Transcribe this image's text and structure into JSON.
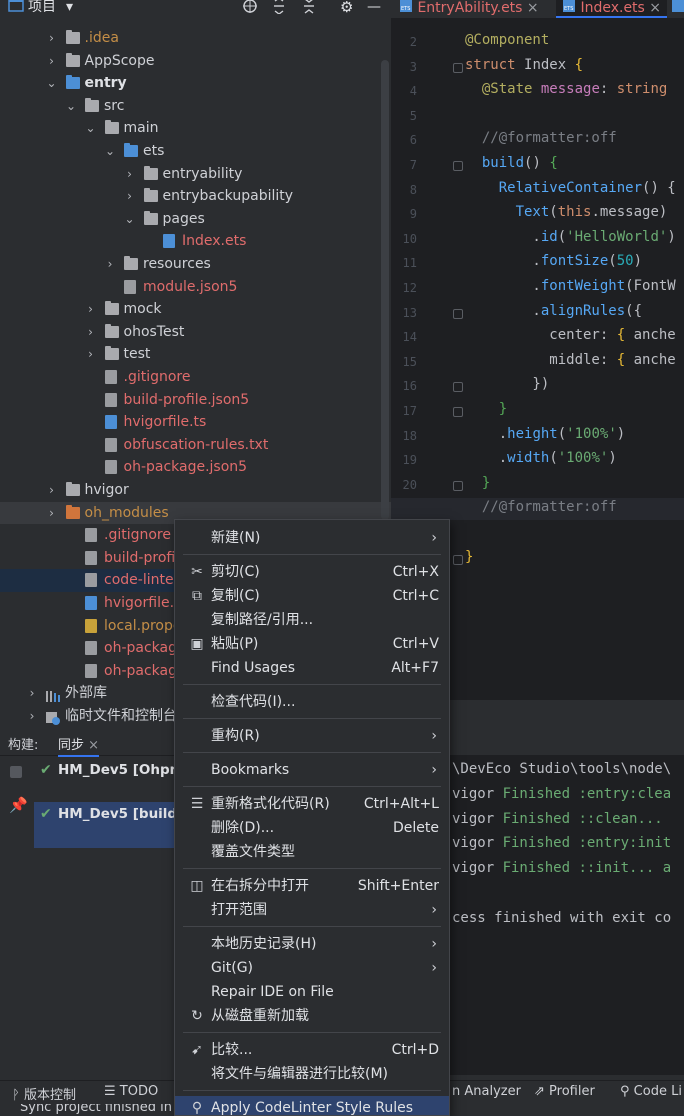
{
  "project_toolbar": {
    "title": "项目",
    "dropdown_glyph": "▾",
    "icons": [
      "target-icon",
      "expand-icon",
      "collapse-icon",
      "gear-icon",
      "minimize-icon"
    ]
  },
  "tabs": [
    {
      "label": "EntryAbility.ets",
      "close": "×"
    },
    {
      "label": "Index.ets",
      "close": "×"
    }
  ],
  "tree": [
    {
      "label": ".idea",
      "color": "orange",
      "depth": 1,
      "chev": "›",
      "icon": "folder"
    },
    {
      "label": "AppScope",
      "color": "norm",
      "depth": 1,
      "chev": "›",
      "icon": "folder"
    },
    {
      "label": "entry",
      "color": "bold",
      "depth": 1,
      "chev": "⌄",
      "icon": "folder-module"
    },
    {
      "label": "src",
      "color": "norm",
      "depth": 2,
      "chev": "⌄",
      "icon": "folder"
    },
    {
      "label": "main",
      "color": "norm",
      "depth": 3,
      "chev": "⌄",
      "icon": "folder"
    },
    {
      "label": "ets",
      "color": "norm",
      "depth": 4,
      "chev": "⌄",
      "icon": "folder-blue"
    },
    {
      "label": "entryability",
      "color": "norm",
      "depth": 5,
      "chev": "›",
      "icon": "folder"
    },
    {
      "label": "entrybackupability",
      "color": "norm",
      "depth": 5,
      "chev": "›",
      "icon": "folder"
    },
    {
      "label": "pages",
      "color": "norm",
      "depth": 5,
      "chev": "⌄",
      "icon": "folder"
    },
    {
      "label": "Index.ets",
      "color": "red",
      "depth": 6,
      "chev": "",
      "icon": "file-ets"
    },
    {
      "label": "resources",
      "color": "norm",
      "depth": 4,
      "chev": "›",
      "icon": "folder"
    },
    {
      "label": "module.json5",
      "color": "red",
      "depth": 4,
      "chev": "",
      "icon": "file-gear"
    },
    {
      "label": "mock",
      "color": "norm",
      "depth": 3,
      "chev": "›",
      "icon": "folder"
    },
    {
      "label": "ohosTest",
      "color": "norm",
      "depth": 3,
      "chev": "›",
      "icon": "folder"
    },
    {
      "label": "test",
      "color": "norm",
      "depth": 3,
      "chev": "›",
      "icon": "folder"
    },
    {
      "label": ".gitignore",
      "color": "red",
      "depth": 3,
      "chev": "",
      "icon": "file-gear"
    },
    {
      "label": "build-profile.json5",
      "color": "red",
      "depth": 3,
      "chev": "",
      "icon": "file-gear"
    },
    {
      "label": "hvigorfile.ts",
      "color": "red",
      "depth": 3,
      "chev": "",
      "icon": "file-ts"
    },
    {
      "label": "obfuscation-rules.txt",
      "color": "red",
      "depth": 3,
      "chev": "",
      "icon": "file-txt"
    },
    {
      "label": "oh-package.json5",
      "color": "red",
      "depth": 3,
      "chev": "",
      "icon": "file-gear"
    },
    {
      "label": "hvigor",
      "color": "norm",
      "depth": 1,
      "chev": "›",
      "icon": "folder"
    },
    {
      "label": "oh_modules",
      "color": "orange",
      "depth": 1,
      "chev": "›",
      "icon": "folder-orange",
      "state": "hover"
    },
    {
      "label": ".gitignore",
      "color": "red",
      "depth": 2,
      "chev": "",
      "icon": "file-gear"
    },
    {
      "label": "build-profile.jso",
      "color": "red",
      "depth": 2,
      "chev": "",
      "icon": "file-gear"
    },
    {
      "label": "code-linter.json!",
      "color": "red",
      "depth": 2,
      "chev": "",
      "icon": "file-gear",
      "state": "selected"
    },
    {
      "label": "hvigorfile.ts",
      "color": "red",
      "depth": 2,
      "chev": "",
      "icon": "file-ts"
    },
    {
      "label": "local.properties",
      "color": "orange",
      "depth": 2,
      "chev": "",
      "icon": "file-prop"
    },
    {
      "label": "oh-package.jsor",
      "color": "red",
      "depth": 2,
      "chev": "",
      "icon": "file-gear"
    },
    {
      "label": "oh-package-loc",
      "color": "red",
      "depth": 2,
      "chev": "",
      "icon": "file-gear"
    },
    {
      "label": "外部库",
      "color": "norm",
      "depth": 0,
      "chev": "›",
      "icon": "library"
    },
    {
      "label": "临时文件和控制台",
      "color": "norm",
      "depth": 0,
      "chev": "›",
      "icon": "scratch"
    }
  ],
  "editor": {
    "line_numbers": [
      "2",
      "3",
      "4",
      "5",
      "6",
      "7",
      "8",
      "9",
      "10",
      "11",
      "12",
      "13",
      "14",
      "15",
      "16",
      "17",
      "18",
      "19",
      "20",
      "21",
      "",
      ""
    ],
    "current_line": "21",
    "lines": [
      [
        [
          "@Component",
          "k-ann"
        ]
      ],
      [
        [
          "struct ",
          "k-kw"
        ],
        [
          "Index ",
          "k-cls"
        ],
        [
          "{",
          "k-br1"
        ]
      ],
      [
        [
          "  ",
          ""
        ],
        [
          "@State ",
          "k-ann"
        ],
        [
          "message",
          "k-prop"
        ],
        [
          ": ",
          ""
        ],
        [
          "string",
          "k-kw"
        ]
      ],
      [
        [
          "",
          ""
        ]
      ],
      [
        [
          "  ",
          ""
        ],
        [
          "//@formatter:off",
          "k-cm"
        ]
      ],
      [
        [
          "  ",
          ""
        ],
        [
          "build",
          "k-fn"
        ],
        [
          "() ",
          ""
        ],
        [
          "{",
          "k-br2"
        ]
      ],
      [
        [
          "    ",
          ""
        ],
        [
          "RelativeContainer",
          "k-fn"
        ],
        [
          "() {",
          ""
        ]
      ],
      [
        [
          "      ",
          ""
        ],
        [
          "Text",
          "k-fn"
        ],
        [
          "(",
          ""
        ],
        [
          "this",
          "k-kw"
        ],
        [
          ".message)",
          ""
        ]
      ],
      [
        [
          "        .",
          ""
        ],
        [
          "id",
          "k-fn"
        ],
        [
          "(",
          ""
        ],
        [
          "'HelloWorld'",
          "k-str"
        ],
        [
          ")",
          ""
        ]
      ],
      [
        [
          "        .",
          ""
        ],
        [
          "fontSize",
          "k-fn"
        ],
        [
          "(",
          ""
        ],
        [
          "50",
          "k-num"
        ],
        [
          ")",
          ""
        ]
      ],
      [
        [
          "        .",
          ""
        ],
        [
          "fontWeight",
          "k-fn"
        ],
        [
          "(FontW",
          ""
        ]
      ],
      [
        [
          "        .",
          ""
        ],
        [
          "alignRules",
          "k-fn"
        ],
        [
          "({",
          ""
        ]
      ],
      [
        [
          "          center: ",
          ""
        ],
        [
          "{ ",
          "k-br1"
        ],
        [
          "anche",
          ""
        ]
      ],
      [
        [
          "          middle: ",
          ""
        ],
        [
          "{ ",
          "k-br1"
        ],
        [
          "anche",
          ""
        ]
      ],
      [
        [
          "        })",
          ""
        ]
      ],
      [
        [
          "    ",
          ""
        ],
        [
          "}",
          "k-br2"
        ]
      ],
      [
        [
          "    .",
          ""
        ],
        [
          "height",
          "k-fn"
        ],
        [
          "(",
          ""
        ],
        [
          "'100%'",
          "k-str"
        ],
        [
          ")",
          ""
        ]
      ],
      [
        [
          "    .",
          ""
        ],
        [
          "width",
          "k-fn"
        ],
        [
          "(",
          ""
        ],
        [
          "'100%'",
          "k-str"
        ],
        [
          ")",
          ""
        ]
      ],
      [
        [
          "  ",
          ""
        ],
        [
          "}",
          "k-br2"
        ]
      ],
      [
        [
          "  ",
          ""
        ],
        [
          "//@formatter:off",
          "k-cm"
        ]
      ],
      [
        [
          "",
          ""
        ]
      ],
      [
        [
          "}",
          "k-br1"
        ]
      ]
    ]
  },
  "build": {
    "tab_label": "构建:",
    "tab_sync": "同步",
    "tab_close": "×",
    "tasks": [
      {
        "check": "✔",
        "label": "HM_Dev5 [Ohpm"
      },
      {
        "check": "✔",
        "label": "HM_Dev5 [build i"
      }
    ],
    "console": [
      [
        [
          "\\DevEco Studio\\tools\\node\\",
          ""
        ]
      ],
      [
        [
          "vigor ",
          ""
        ],
        [
          "Finished ",
          "c-green"
        ],
        [
          ":entry:clea",
          "c-green"
        ]
      ],
      [
        [
          "vigor ",
          ""
        ],
        [
          "Finished ",
          "c-green"
        ],
        [
          "::clean...",
          "c-green"
        ]
      ],
      [
        [
          "vigor ",
          ""
        ],
        [
          "Finished ",
          "c-green"
        ],
        [
          ":entry:init",
          "c-green"
        ]
      ],
      [
        [
          "vigor ",
          ""
        ],
        [
          "Finished ",
          "c-green"
        ],
        [
          "::init... a",
          "c-green"
        ]
      ],
      [
        [
          "",
          ""
        ]
      ],
      [
        [
          "cess finished with exit co",
          ""
        ]
      ]
    ]
  },
  "bottom_bar": [
    {
      "icon": "branch-icon",
      "glyph": "ᚹ",
      "label": "版本控制"
    },
    {
      "icon": "todo-icon",
      "glyph": "☰",
      "label": "TODO"
    },
    {
      "icon": "",
      "glyph": "",
      "label": "n Analyzer"
    },
    {
      "icon": "profiler-icon",
      "glyph": "⇗",
      "label": "Profiler"
    },
    {
      "icon": "codelinter-icon",
      "glyph": "⚲",
      "label": "Code Li"
    }
  ],
  "status_text": "Sync project finished in",
  "menu": {
    "items": [
      {
        "label": "新建(N)",
        "icon": "",
        "shortcut": "",
        "sub": true
      },
      {
        "sep": true
      },
      {
        "label": "剪切(C)",
        "icon": "✂",
        "iconName": "cut-icon",
        "shortcut": "Ctrl+X"
      },
      {
        "label": "复制(C)",
        "icon": "⧉",
        "iconName": "copy-icon",
        "shortcut": "Ctrl+C"
      },
      {
        "label": "复制路径/引用...",
        "icon": "",
        "shortcut": ""
      },
      {
        "label": "粘贴(P)",
        "icon": "▣",
        "iconName": "paste-icon",
        "shortcut": "Ctrl+V"
      },
      {
        "label": "Find Usages",
        "icon": "",
        "shortcut": "Alt+F7"
      },
      {
        "sep": true
      },
      {
        "label": "检查代码(I)...",
        "icon": "",
        "shortcut": ""
      },
      {
        "sep": true
      },
      {
        "label": "重构(R)",
        "icon": "",
        "shortcut": "",
        "sub": true
      },
      {
        "sep": true
      },
      {
        "label": "Bookmarks",
        "icon": "",
        "shortcut": "",
        "sub": true
      },
      {
        "sep": true
      },
      {
        "label": "重新格式化代码(R)",
        "icon": "☰",
        "iconName": "reformat-icon",
        "shortcut": "Ctrl+Alt+L"
      },
      {
        "label": "删除(D)...",
        "icon": "",
        "shortcut": "Delete"
      },
      {
        "label": "覆盖文件类型",
        "icon": "",
        "shortcut": ""
      },
      {
        "sep": true
      },
      {
        "label": "在右拆分中打开",
        "icon": "◫",
        "iconName": "split-icon",
        "shortcut": "Shift+Enter"
      },
      {
        "label": "打开范围",
        "icon": "",
        "shortcut": "",
        "sub": true
      },
      {
        "sep": true
      },
      {
        "label": "本地历史记录(H)",
        "icon": "",
        "shortcut": "",
        "sub": true
      },
      {
        "label": "Git(G)",
        "icon": "",
        "shortcut": "",
        "sub": true
      },
      {
        "label": "Repair IDE on File",
        "icon": "",
        "shortcut": ""
      },
      {
        "label": "从磁盘重新加载",
        "icon": "↻",
        "iconName": "reload-icon",
        "shortcut": ""
      },
      {
        "sep": true
      },
      {
        "label": "比较...",
        "icon": "➹",
        "iconName": "compare-icon",
        "shortcut": "Ctrl+D"
      },
      {
        "label": "将文件与编辑器进行比较(M)",
        "icon": "",
        "shortcut": ""
      },
      {
        "sep": true
      },
      {
        "label": "Apply CodeLinter Style Rules",
        "icon": "⚲",
        "iconName": "codelinter-icon",
        "shortcut": "",
        "active": true
      }
    ],
    "submenu_glyph": "›"
  }
}
